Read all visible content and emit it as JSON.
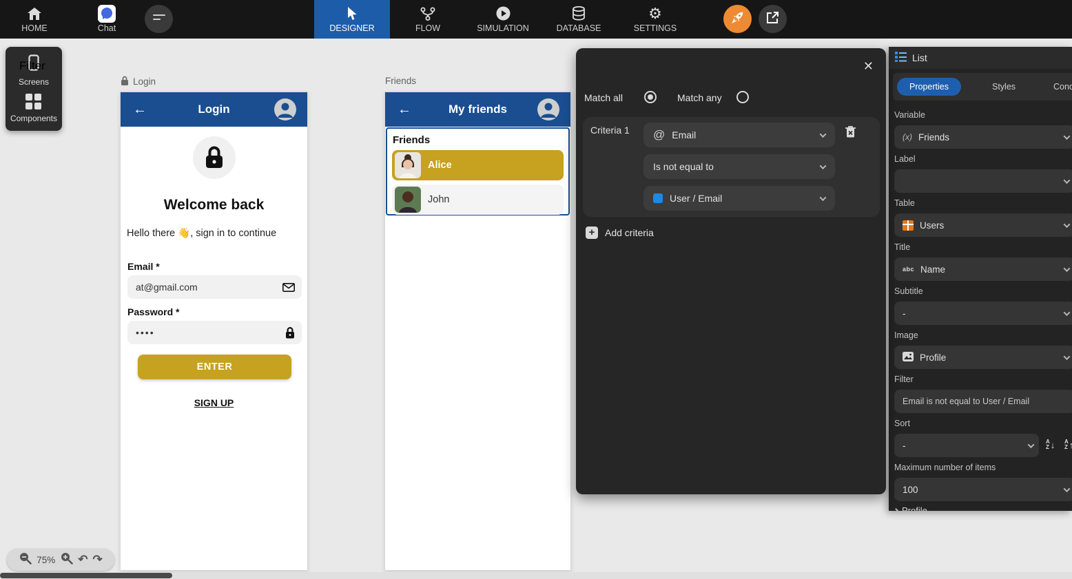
{
  "topbar": {
    "home": "HOME",
    "chat": "Chat",
    "designer": "DESIGNER",
    "flow": "FLOW",
    "simulation": "SIMULATION",
    "database": "DATABASE",
    "settings": "SETTINGS"
  },
  "left_toolbar": {
    "screens": "Screens",
    "components": "Components"
  },
  "canvas": {
    "login_screen": {
      "label": "Login",
      "title": "Login",
      "heading": "Welcome back",
      "subheading": "Hello there 👋, sign in to continue",
      "email_label": "Email *",
      "email_value": "at@gmail.com",
      "password_label": "Password *",
      "password_value": "••••",
      "enter_button": "ENTER",
      "signup_link": "SIGN UP"
    },
    "friends_screen": {
      "label": "Friends",
      "title": "My friends",
      "list_heading": "Friends",
      "items": [
        {
          "name": "Alice"
        },
        {
          "name": "John"
        }
      ]
    }
  },
  "filter_panel": {
    "title": "Filter",
    "match_all": "Match all",
    "match_any": "Match any",
    "match_mode": "all",
    "criteria": [
      {
        "label": "Criteria 1",
        "field": "Email",
        "operator": "Is not equal to",
        "value": "User / Email"
      }
    ],
    "add_criteria": "Add criteria"
  },
  "right_panel": {
    "component": "List",
    "tabs": [
      "Properties",
      "Styles",
      "Condition"
    ],
    "active_tab": "Properties",
    "fields": {
      "variable": {
        "label": "Variable",
        "icon": "variable-x",
        "value": "Friends"
      },
      "label_field": {
        "label": "Label",
        "value": ""
      },
      "table": {
        "label": "Table",
        "icon": "table",
        "value": "Users"
      },
      "title": {
        "label": "Title",
        "icon": "abc",
        "value": "Name"
      },
      "subtitle": {
        "label": "Subtitle",
        "value": "-"
      },
      "image": {
        "label": "Image",
        "icon": "image",
        "value": "Profile"
      },
      "filter": {
        "label": "Filter",
        "value": "Email is not equal to User / Email"
      },
      "sort": {
        "label": "Sort",
        "value": "-"
      },
      "max_items": {
        "label": "Maximum number of items",
        "value": "100"
      },
      "truncated_section": "Profile"
    }
  },
  "zoom_controls": {
    "level": "75%"
  },
  "colors": {
    "accent_blue": "#1d5ca9",
    "header_blue": "#1a4e91",
    "gold": "#c7a120",
    "panel_dark": "#262626",
    "rocket_orange": "#ed8a33",
    "variable_blue": "#1e88e5",
    "table_orange": "#e2791f"
  }
}
